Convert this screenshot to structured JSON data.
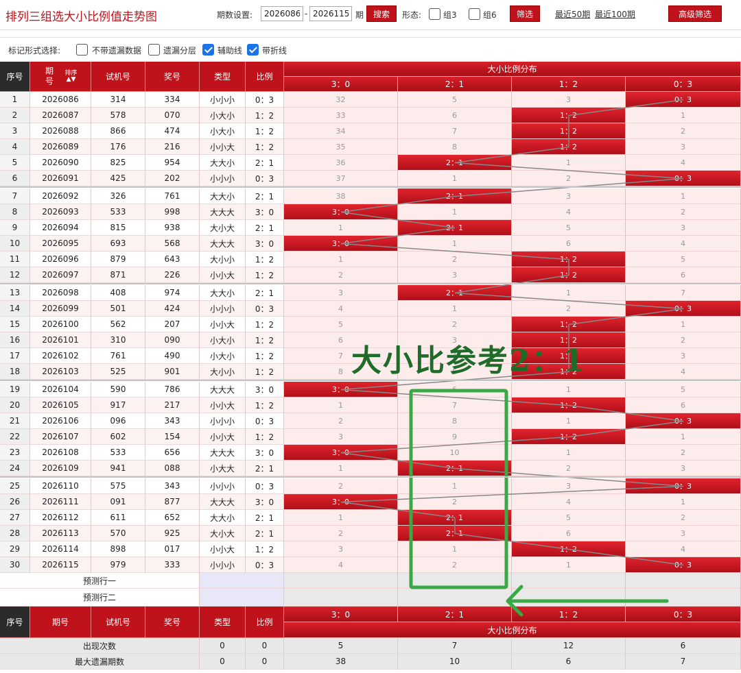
{
  "header": {
    "title": "排列三组选大小比例值走势图",
    "period_label": "期数设置:",
    "from": "2026086",
    "dash": "-",
    "to": "2026115",
    "period_suffix": "期",
    "search_label": "搜索",
    "form_label": "形态:",
    "group3": "组3",
    "group6": "组6",
    "filter_label": "筛选",
    "recent50": "最近50期",
    "recent100": "最近100期",
    "advanced_label": "高级筛选"
  },
  "options": {
    "label": "标记形式选择:",
    "items": [
      {
        "label": "不带遗漏数据",
        "checked": false
      },
      {
        "label": "遗漏分层",
        "checked": false
      },
      {
        "label": "辅助线",
        "checked": true
      },
      {
        "label": "带折线",
        "checked": true
      }
    ]
  },
  "table": {
    "headers": {
      "seq": "序号",
      "issue": "期号",
      "sort": "排序",
      "trial": "试机号",
      "prize": "奖号",
      "type": "类型",
      "ratio": "比例",
      "dist": "大小比例分布"
    },
    "cols": [
      "3：0",
      "2：1",
      "1：2",
      "0：3"
    ],
    "rows": [
      [
        "1",
        "2026086",
        "314",
        "334",
        "小小小",
        "0：3",
        32,
        5,
        3,
        "0：3"
      ],
      [
        "2",
        "2026087",
        "578",
        "070",
        "小大小",
        "1：2",
        33,
        6,
        "1：2",
        1
      ],
      [
        "3",
        "2026088",
        "866",
        "474",
        "小大小",
        "1：2",
        34,
        7,
        "1：2",
        2
      ],
      [
        "4",
        "2026089",
        "176",
        "216",
        "小小大",
        "1：2",
        35,
        8,
        "1：2",
        3
      ],
      [
        "5",
        "2026090",
        "825",
        "954",
        "大大小",
        "2：1",
        36,
        "2：1",
        1,
        4
      ],
      [
        "6",
        "2026091",
        "425",
        "202",
        "小小小",
        "0：3",
        37,
        1,
        2,
        "0：3"
      ],
      [
        "7",
        "2026092",
        "326",
        "761",
        "大大小",
        "2：1",
        38,
        "2：1",
        3,
        1
      ],
      [
        "8",
        "2026093",
        "533",
        "998",
        "大大大",
        "3：0",
        "3：0",
        1,
        4,
        2
      ],
      [
        "9",
        "2026094",
        "815",
        "938",
        "大小大",
        "2：1",
        1,
        "2：1",
        5,
        3
      ],
      [
        "10",
        "2026095",
        "693",
        "568",
        "大大大",
        "3：0",
        "3：0",
        1,
        6,
        4
      ],
      [
        "11",
        "2026096",
        "879",
        "643",
        "大小小",
        "1：2",
        1,
        2,
        "1：2",
        5
      ],
      [
        "12",
        "2026097",
        "871",
        "226",
        "小小大",
        "1：2",
        2,
        3,
        "1：2",
        6
      ],
      [
        "13",
        "2026098",
        "408",
        "974",
        "大大小",
        "2：1",
        3,
        "2：1",
        1,
        7
      ],
      [
        "14",
        "2026099",
        "501",
        "424",
        "小小小",
        "0：3",
        4,
        1,
        2,
        "0：3"
      ],
      [
        "15",
        "2026100",
        "562",
        "207",
        "小小大",
        "1：2",
        5,
        2,
        "1：2",
        1
      ],
      [
        "16",
        "2026101",
        "310",
        "090",
        "小大小",
        "1：2",
        6,
        3,
        "1：2",
        2
      ],
      [
        "17",
        "2026102",
        "761",
        "490",
        "小大小",
        "1：2",
        7,
        4,
        "1：2",
        3
      ],
      [
        "18",
        "2026103",
        "525",
        "901",
        "大小小",
        "1：2",
        8,
        5,
        "1：2",
        4
      ],
      [
        "19",
        "2026104",
        "590",
        "786",
        "大大大",
        "3：0",
        "3：0",
        6,
        1,
        5
      ],
      [
        "20",
        "2026105",
        "917",
        "217",
        "小小大",
        "1：2",
        1,
        7,
        "1：2",
        6
      ],
      [
        "21",
        "2026106",
        "096",
        "343",
        "小小小",
        "0：3",
        2,
        8,
        1,
        "0：3"
      ],
      [
        "22",
        "2026107",
        "602",
        "154",
        "小小大",
        "1：2",
        3,
        9,
        "1：2",
        1
      ],
      [
        "23",
        "2026108",
        "533",
        "656",
        "大大大",
        "3：0",
        "3：0",
        10,
        1,
        2
      ],
      [
        "24",
        "2026109",
        "941",
        "088",
        "小大大",
        "2：1",
        1,
        "2：1",
        2,
        3
      ],
      [
        "25",
        "2026110",
        "575",
        "343",
        "小小小",
        "0：3",
        2,
        1,
        3,
        "0：3"
      ],
      [
        "26",
        "2026111",
        "091",
        "877",
        "大大大",
        "3：0",
        "3：0",
        2,
        4,
        1
      ],
      [
        "27",
        "2026112",
        "611",
        "652",
        "大大小",
        "2：1",
        1,
        "2：1",
        5,
        2
      ],
      [
        "28",
        "2026113",
        "570",
        "925",
        "大小大",
        "2：1",
        2,
        "2：1",
        6,
        3
      ],
      [
        "29",
        "2026114",
        "898",
        "017",
        "小小大",
        "1：2",
        3,
        1,
        "1：2",
        4
      ],
      [
        "30",
        "2026115",
        "979",
        "333",
        "小小小",
        "0：3",
        4,
        2,
        1,
        "0：3"
      ]
    ],
    "predict1": "预测行一",
    "predict2": "预测行二",
    "stats": [
      {
        "label": "出现次数",
        "type": "0",
        "ratio": "0",
        "vals": [
          "5",
          "7",
          "12",
          "6"
        ]
      },
      {
        "label": "最大遗漏期数",
        "type": "0",
        "ratio": "0",
        "vals": [
          "38",
          "10",
          "6",
          "7"
        ]
      }
    ]
  },
  "annotation": {
    "text": "大小比参考2：1",
    "color": "#3aa845"
  },
  "colors": {
    "accent": "#c0121a",
    "hit": "#d0181f",
    "miss_bg": "#fdecec"
  }
}
